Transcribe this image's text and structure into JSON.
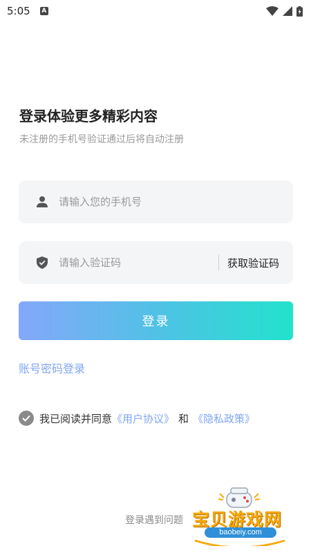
{
  "status_bar": {
    "time": "5:05",
    "notification_badge": "A"
  },
  "header": {
    "title": "登录体验更多精彩内容",
    "subtitle": "未注册的手机号验证通过后将自动注册"
  },
  "phone_field": {
    "placeholder": "请输入您的手机号",
    "icon": "user-icon"
  },
  "code_field": {
    "placeholder": "请输入验证码",
    "icon": "shield-icon",
    "get_code_label": "获取验证码"
  },
  "login_button": {
    "label": "登录"
  },
  "account_login": {
    "label": "账号密码登录"
  },
  "agreement": {
    "checked": true,
    "prefix": "我已阅读并同意",
    "user_agreement": "《用户协议》",
    "and": "和",
    "privacy_policy": "《隐私政策》"
  },
  "help": {
    "label": "登录遇到问题"
  },
  "watermark": {
    "title": "宝贝游戏网",
    "url": "baobeiy.com"
  },
  "colors": {
    "accent_link": "#7fa6f2",
    "button_gradient_start": "#84a7fa",
    "button_gradient_end": "#22e2cc",
    "field_bg": "#f4f5f7"
  }
}
